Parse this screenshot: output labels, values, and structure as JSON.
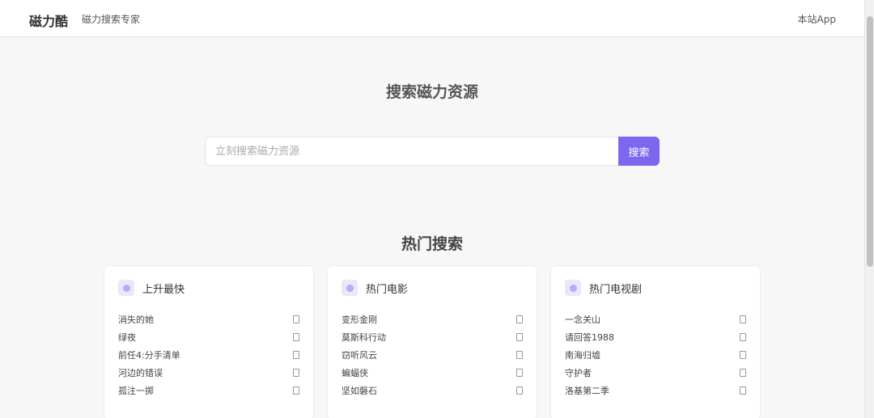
{
  "header": {
    "brand": "磁力酷",
    "tagline": "磁力搜索专家",
    "app_link": "本站App"
  },
  "hero": {
    "title": "搜索磁力资源",
    "search_placeholder": "立刻搜索磁力资源",
    "search_button": "搜索"
  },
  "hot": {
    "title": "热门搜索",
    "cards": [
      {
        "title": "上升最快",
        "items": [
          "消失的她",
          "绿夜",
          "前任4:分手清单",
          "河边的错误",
          "孤注一掷"
        ]
      },
      {
        "title": "热门电影",
        "items": [
          "变形金刚",
          "莫斯科行动",
          "窃听风云",
          "蝙蝠侠",
          "坚如磐石"
        ]
      },
      {
        "title": "热门电视剧",
        "items": [
          "一念关山",
          "请回答1988",
          "南海归墟",
          "守护者",
          "洛基第二季"
        ]
      }
    ]
  },
  "colors": {
    "accent": "#7b68ee",
    "badge_bg": "#ebe7fb",
    "page_bg": "#f7f7f8"
  },
  "icons": {
    "card_badge": "dot-icon",
    "row_action": "bookmark-icon"
  }
}
